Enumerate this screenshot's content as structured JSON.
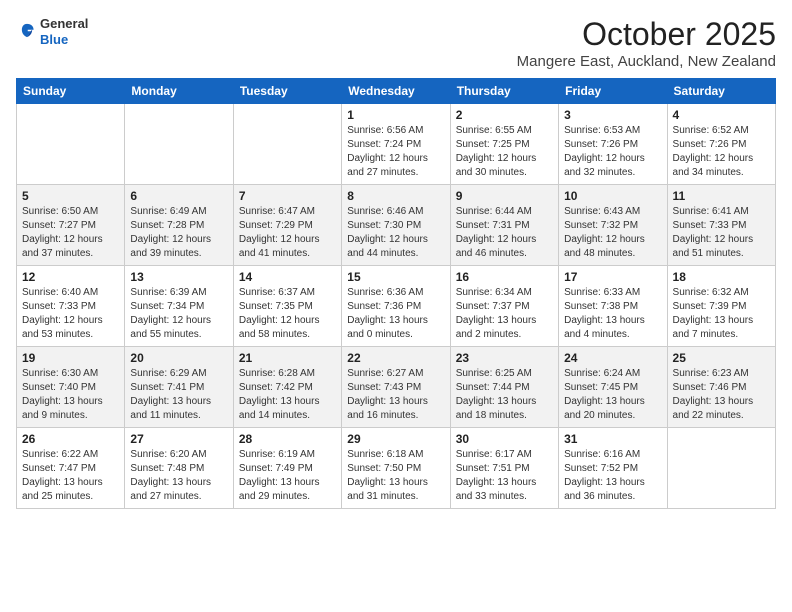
{
  "header": {
    "logo_line1": "General",
    "logo_line2": "Blue",
    "month_year": "October 2025",
    "location": "Mangere East, Auckland, New Zealand"
  },
  "weekdays": [
    "Sunday",
    "Monday",
    "Tuesday",
    "Wednesday",
    "Thursday",
    "Friday",
    "Saturday"
  ],
  "weeks": [
    [
      {
        "day": "",
        "content": ""
      },
      {
        "day": "",
        "content": ""
      },
      {
        "day": "",
        "content": ""
      },
      {
        "day": "1",
        "content": "Sunrise: 6:56 AM\nSunset: 7:24 PM\nDaylight: 12 hours\nand 27 minutes."
      },
      {
        "day": "2",
        "content": "Sunrise: 6:55 AM\nSunset: 7:25 PM\nDaylight: 12 hours\nand 30 minutes."
      },
      {
        "day": "3",
        "content": "Sunrise: 6:53 AM\nSunset: 7:26 PM\nDaylight: 12 hours\nand 32 minutes."
      },
      {
        "day": "4",
        "content": "Sunrise: 6:52 AM\nSunset: 7:26 PM\nDaylight: 12 hours\nand 34 minutes."
      }
    ],
    [
      {
        "day": "5",
        "content": "Sunrise: 6:50 AM\nSunset: 7:27 PM\nDaylight: 12 hours\nand 37 minutes."
      },
      {
        "day": "6",
        "content": "Sunrise: 6:49 AM\nSunset: 7:28 PM\nDaylight: 12 hours\nand 39 minutes."
      },
      {
        "day": "7",
        "content": "Sunrise: 6:47 AM\nSunset: 7:29 PM\nDaylight: 12 hours\nand 41 minutes."
      },
      {
        "day": "8",
        "content": "Sunrise: 6:46 AM\nSunset: 7:30 PM\nDaylight: 12 hours\nand 44 minutes."
      },
      {
        "day": "9",
        "content": "Sunrise: 6:44 AM\nSunset: 7:31 PM\nDaylight: 12 hours\nand 46 minutes."
      },
      {
        "day": "10",
        "content": "Sunrise: 6:43 AM\nSunset: 7:32 PM\nDaylight: 12 hours\nand 48 minutes."
      },
      {
        "day": "11",
        "content": "Sunrise: 6:41 AM\nSunset: 7:33 PM\nDaylight: 12 hours\nand 51 minutes."
      }
    ],
    [
      {
        "day": "12",
        "content": "Sunrise: 6:40 AM\nSunset: 7:33 PM\nDaylight: 12 hours\nand 53 minutes."
      },
      {
        "day": "13",
        "content": "Sunrise: 6:39 AM\nSunset: 7:34 PM\nDaylight: 12 hours\nand 55 minutes."
      },
      {
        "day": "14",
        "content": "Sunrise: 6:37 AM\nSunset: 7:35 PM\nDaylight: 12 hours\nand 58 minutes."
      },
      {
        "day": "15",
        "content": "Sunrise: 6:36 AM\nSunset: 7:36 PM\nDaylight: 13 hours\nand 0 minutes."
      },
      {
        "day": "16",
        "content": "Sunrise: 6:34 AM\nSunset: 7:37 PM\nDaylight: 13 hours\nand 2 minutes."
      },
      {
        "day": "17",
        "content": "Sunrise: 6:33 AM\nSunset: 7:38 PM\nDaylight: 13 hours\nand 4 minutes."
      },
      {
        "day": "18",
        "content": "Sunrise: 6:32 AM\nSunset: 7:39 PM\nDaylight: 13 hours\nand 7 minutes."
      }
    ],
    [
      {
        "day": "19",
        "content": "Sunrise: 6:30 AM\nSunset: 7:40 PM\nDaylight: 13 hours\nand 9 minutes."
      },
      {
        "day": "20",
        "content": "Sunrise: 6:29 AM\nSunset: 7:41 PM\nDaylight: 13 hours\nand 11 minutes."
      },
      {
        "day": "21",
        "content": "Sunrise: 6:28 AM\nSunset: 7:42 PM\nDaylight: 13 hours\nand 14 minutes."
      },
      {
        "day": "22",
        "content": "Sunrise: 6:27 AM\nSunset: 7:43 PM\nDaylight: 13 hours\nand 16 minutes."
      },
      {
        "day": "23",
        "content": "Sunrise: 6:25 AM\nSunset: 7:44 PM\nDaylight: 13 hours\nand 18 minutes."
      },
      {
        "day": "24",
        "content": "Sunrise: 6:24 AM\nSunset: 7:45 PM\nDaylight: 13 hours\nand 20 minutes."
      },
      {
        "day": "25",
        "content": "Sunrise: 6:23 AM\nSunset: 7:46 PM\nDaylight: 13 hours\nand 22 minutes."
      }
    ],
    [
      {
        "day": "26",
        "content": "Sunrise: 6:22 AM\nSunset: 7:47 PM\nDaylight: 13 hours\nand 25 minutes."
      },
      {
        "day": "27",
        "content": "Sunrise: 6:20 AM\nSunset: 7:48 PM\nDaylight: 13 hours\nand 27 minutes."
      },
      {
        "day": "28",
        "content": "Sunrise: 6:19 AM\nSunset: 7:49 PM\nDaylight: 13 hours\nand 29 minutes."
      },
      {
        "day": "29",
        "content": "Sunrise: 6:18 AM\nSunset: 7:50 PM\nDaylight: 13 hours\nand 31 minutes."
      },
      {
        "day": "30",
        "content": "Sunrise: 6:17 AM\nSunset: 7:51 PM\nDaylight: 13 hours\nand 33 minutes."
      },
      {
        "day": "31",
        "content": "Sunrise: 6:16 AM\nSunset: 7:52 PM\nDaylight: 13 hours\nand 36 minutes."
      },
      {
        "day": "",
        "content": ""
      }
    ]
  ]
}
